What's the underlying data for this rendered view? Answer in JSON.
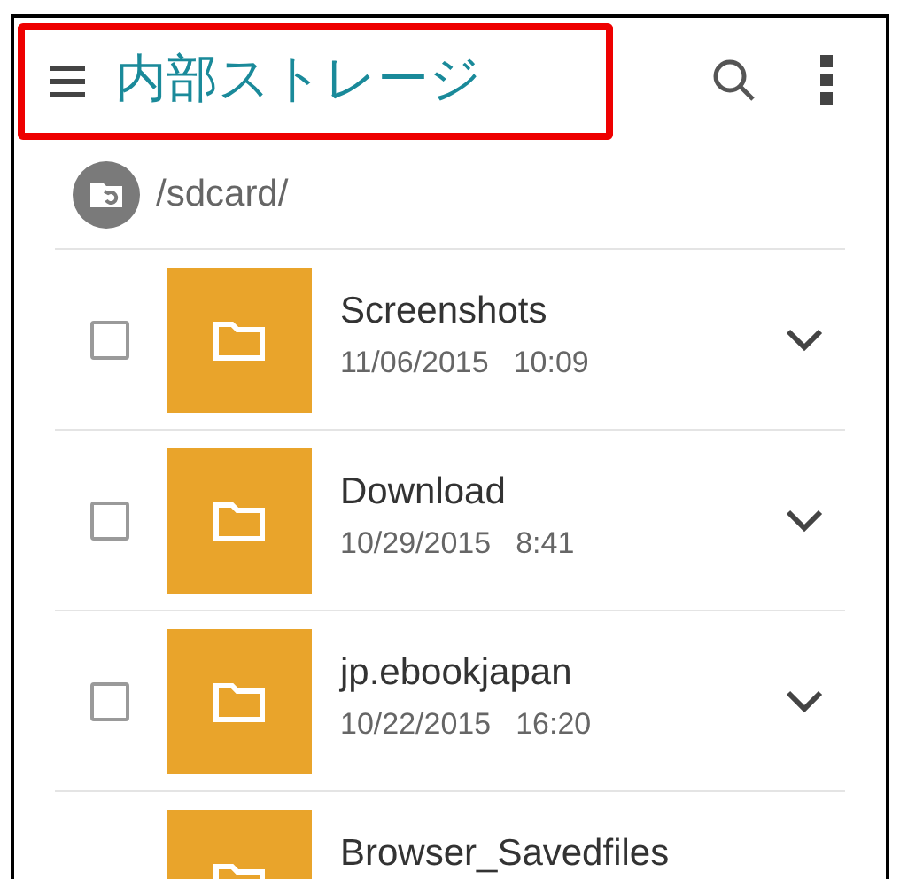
{
  "toolbar": {
    "title": "内部ストレージ",
    "highlighted": true
  },
  "path": {
    "text": "/sdcard/"
  },
  "files": [
    {
      "kind": "folder",
      "name": "Screenshots",
      "date": "11/06/2015",
      "time": "10:09",
      "checked": false
    },
    {
      "kind": "folder",
      "name": "Download",
      "date": "10/29/2015",
      "time": "8:41",
      "checked": false
    },
    {
      "kind": "folder",
      "name": "jp.ebookjapan",
      "date": "10/22/2015",
      "time": "16:20",
      "checked": false
    },
    {
      "kind": "folder",
      "name": "Browser_Savedfiles"
    }
  ]
}
